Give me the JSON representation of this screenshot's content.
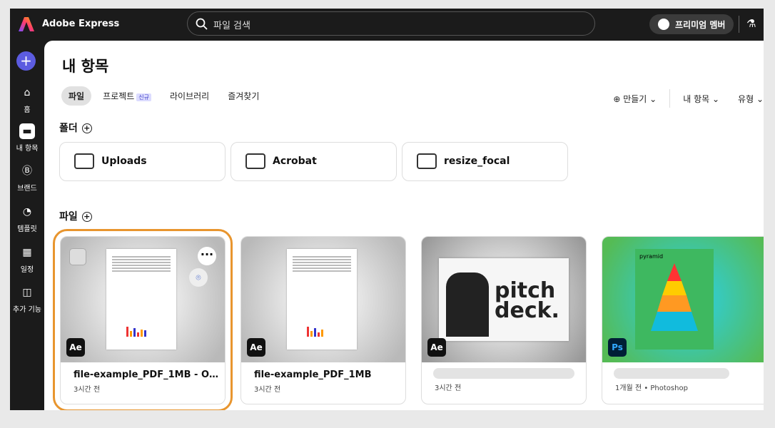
{
  "app": {
    "name": "Adobe Express",
    "search_placeholder": "파일 검색",
    "premium": "프리미엄 멤버"
  },
  "sidebar": [
    {
      "label": "홈",
      "icon": "home-icon"
    },
    {
      "label": "내 항목",
      "icon": "folder-icon",
      "active": true
    },
    {
      "label": "브랜드",
      "icon": "brand-icon"
    },
    {
      "label": "템플릿",
      "icon": "template-icon"
    },
    {
      "label": "일정",
      "icon": "calendar-icon"
    },
    {
      "label": "추가 기능",
      "icon": "addons-icon"
    }
  ],
  "main": {
    "title": "내 항목",
    "tabs": [
      {
        "label": "파일"
      },
      {
        "label": "프로젝트",
        "badge": "신규"
      },
      {
        "label": "라이브러리"
      },
      {
        "label": "즐겨찾기"
      }
    ],
    "create": "만들기",
    "filter_owner": "내 항목",
    "filter_type": "유형",
    "folders_label": "폴더",
    "files_label": "파일",
    "folders": [
      "Uploads",
      "Acrobat",
      "resize_focal"
    ],
    "files": [
      {
        "title": "file-example_PDF_1MB - O…",
        "meta": "3시간 전",
        "app": "Ae"
      },
      {
        "title": "file-example_PDF_1MB",
        "meta": "3시간 전",
        "app": "Ae"
      },
      {
        "title": "",
        "meta": "3시간 전",
        "app": "Ae",
        "thumb": "pitch deck."
      },
      {
        "title": "",
        "meta": "1개월 전 • Photoshop",
        "app": "Ps",
        "thumb": "pyramid"
      }
    ]
  }
}
